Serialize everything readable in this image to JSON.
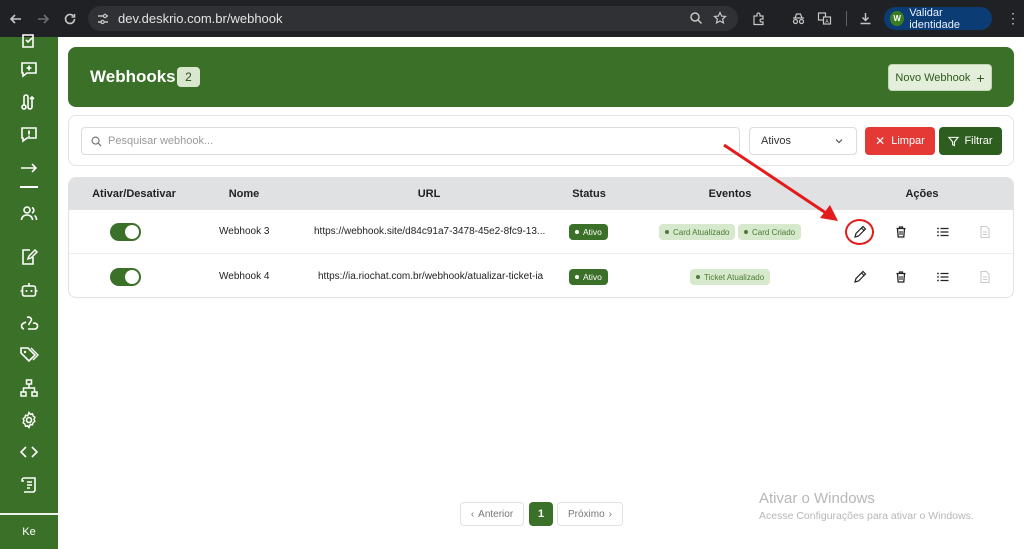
{
  "browser": {
    "url": "dev.deskrio.com.br/webhook",
    "validate_label": "Validar identidade",
    "validate_badge": "W"
  },
  "sidebar": {
    "footer_label": "Ke",
    "icons": [
      "checkbox-icon",
      "message-plus-icon",
      "route-icon",
      "message-alert-icon",
      "arrow-right-icon",
      "users-icon",
      "edit-file-icon",
      "bot-icon",
      "webhook-icon",
      "tags-icon",
      "sitemap-icon",
      "gear-icon",
      "code-icon",
      "scroll-icon"
    ]
  },
  "header": {
    "title": "Webhooks",
    "count": "2",
    "new_button": "Novo Webhook",
    "new_button_icon": "+"
  },
  "filters": {
    "search_placeholder": "Pesquisar webhook...",
    "status_selected": "Ativos",
    "clear_label": "Limpar",
    "filter_label": "Filtrar"
  },
  "table": {
    "headers": {
      "toggle": "Ativar/Desativar",
      "name": "Nome",
      "url": "URL",
      "status": "Status",
      "events": "Eventos",
      "actions": "Ações"
    },
    "rows": [
      {
        "active": true,
        "name": "Webhook 3",
        "url": "https://webhook.site/d84c91a7-3478-45e2-8fc9-13...",
        "status": "Ativo",
        "events": [
          "Card Atualizado",
          "Card Criado"
        ]
      },
      {
        "active": true,
        "name": "Webhook 4",
        "url": "https://ia.riochat.com.br/webhook/atualizar-ticket-ia",
        "status": "Ativo",
        "events": [
          "Ticket Atualizado"
        ]
      }
    ]
  },
  "pagination": {
    "prev_label": "Anterior",
    "current_page": "1",
    "next_label": "Próximo"
  },
  "watermark": {
    "line1": "Ativar o Windows",
    "line2": "Acesse Configurações para ativar o Windows."
  },
  "colors": {
    "brand_green": "#3b7028",
    "danger": "#e53935",
    "annotation_red": "#e31b1b"
  }
}
